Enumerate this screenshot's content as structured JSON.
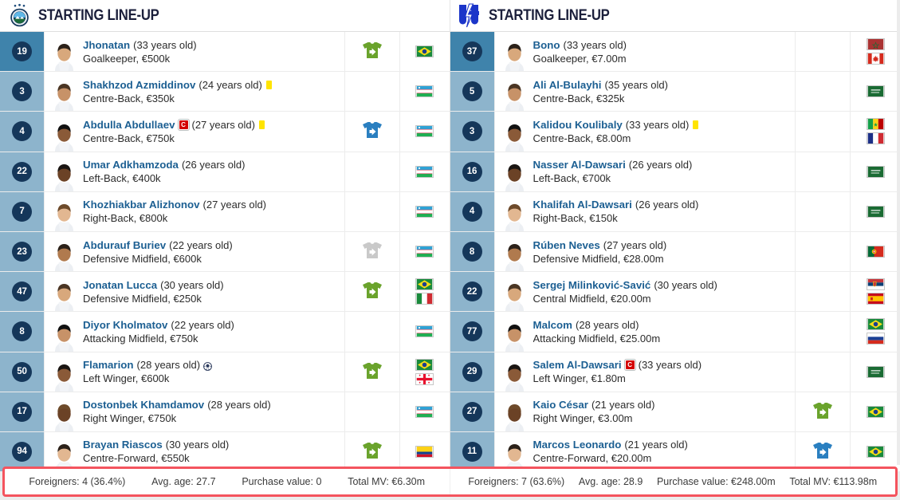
{
  "left": {
    "header": {
      "title": "STARTING LINE-UP",
      "crest_name": "pakhtakor-crest"
    },
    "players": [
      {
        "number": "19",
        "name": "Jhonatan",
        "age": "(33 years old)",
        "position": "Goalkeeper, €500k",
        "captain": false,
        "yellow_card": false,
        "goal": false,
        "sub_off": false,
        "sub_icon": "sub-on-green",
        "flags": [
          "Brazil"
        ],
        "active": true
      },
      {
        "number": "3",
        "name": "Shakhzod Azmiddinov",
        "age": "(24 years old)",
        "position": "Centre-Back, €350k",
        "captain": false,
        "yellow_card": true,
        "goal": false,
        "sub_off": false,
        "sub_icon": "none",
        "flags": [
          "Uzbekistan"
        ],
        "active": false
      },
      {
        "number": "4",
        "name": "Abdulla Abdullaev",
        "age": "(27 years old)",
        "position": "Centre-Back, €750k",
        "captain": true,
        "yellow_card": true,
        "goal": false,
        "sub_off": false,
        "sub_icon": "sub-off-blue",
        "flags": [
          "Uzbekistan"
        ],
        "active": false
      },
      {
        "number": "22",
        "name": "Umar Adkhamzoda",
        "age": "(26 years old)",
        "position": "Left-Back, €400k",
        "captain": false,
        "yellow_card": false,
        "goal": false,
        "sub_off": true,
        "sub_icon": "none",
        "flags": [
          "Uzbekistan"
        ],
        "active": false
      },
      {
        "number": "7",
        "name": "Khozhiakbar Alizhonov",
        "age": "(27 years old)",
        "position": "Right-Back, €800k",
        "captain": false,
        "yellow_card": false,
        "goal": false,
        "sub_off": false,
        "sub_icon": "none",
        "flags": [
          "Uzbekistan"
        ],
        "active": false
      },
      {
        "number": "23",
        "name": "Abdurauf Buriev",
        "age": "(22 years old)",
        "position": "Defensive Midfield, €600k",
        "captain": false,
        "yellow_card": false,
        "goal": false,
        "sub_off": false,
        "sub_icon": "sub-grey",
        "flags": [
          "Uzbekistan"
        ],
        "active": false
      },
      {
        "number": "47",
        "name": "Jonatan Lucca",
        "age": "(30 years old)",
        "position": "Defensive Midfield, €250k",
        "captain": false,
        "yellow_card": false,
        "goal": false,
        "sub_off": false,
        "sub_icon": "sub-on-green",
        "flags": [
          "Brazil",
          "Italy"
        ],
        "active": false
      },
      {
        "number": "8",
        "name": "Diyor Kholmatov",
        "age": "(22 years old)",
        "position": "Attacking Midfield, €750k",
        "captain": false,
        "yellow_card": false,
        "goal": false,
        "sub_off": true,
        "sub_icon": "none",
        "flags": [
          "Uzbekistan"
        ],
        "active": false
      },
      {
        "number": "50",
        "name": "Flamarion",
        "age": "(28 years old)",
        "position": "Left Winger, €600k",
        "captain": false,
        "yellow_card": false,
        "goal": true,
        "sub_off": true,
        "sub_icon": "sub-on-green",
        "flags": [
          "Brazil",
          "Georgia"
        ],
        "active": false
      },
      {
        "number": "17",
        "name": "Dostonbek Khamdamov",
        "age": "(28 years old)",
        "position": "Right Winger, €750k",
        "captain": false,
        "yellow_card": false,
        "goal": false,
        "sub_off": true,
        "sub_icon": "none",
        "flags": [
          "Uzbekistan"
        ],
        "active": false
      },
      {
        "number": "94",
        "name": "Brayan Riascos",
        "age": "(30 years old)",
        "position": "Centre-Forward, €550k",
        "captain": false,
        "yellow_card": false,
        "goal": false,
        "sub_off": true,
        "sub_icon": "sub-on-green",
        "flags": [
          "Colombia"
        ],
        "active": false
      }
    ],
    "summary": {
      "foreigners": "Foreigners: 4 (36.4%)",
      "avg_age": "Avg. age: 27.7",
      "purchase_value": "Purchase value: 0",
      "total_mv": "Total MV: €6.30m"
    }
  },
  "right": {
    "header": {
      "title": "STARTING LINE-UP",
      "crest_name": "al-hilal-crest"
    },
    "players": [
      {
        "number": "37",
        "name": "Bono",
        "age": "(33 years old)",
        "position": "Goalkeeper, €7.00m",
        "captain": false,
        "yellow_card": false,
        "goal": false,
        "sub_off": false,
        "sub_icon": "none",
        "flags": [
          "Morocco",
          "Canada"
        ],
        "active": true
      },
      {
        "number": "5",
        "name": "Ali Al-Bulayhi",
        "age": "(35 years old)",
        "position": "Centre-Back, €325k",
        "captain": false,
        "yellow_card": false,
        "goal": false,
        "sub_off": true,
        "sub_icon": "none",
        "flags": [
          "Saudi Arabia"
        ],
        "active": false
      },
      {
        "number": "3",
        "name": "Kalidou Koulibaly",
        "age": "(33 years old)",
        "position": "Centre-Back, €8.00m",
        "captain": false,
        "yellow_card": true,
        "goal": false,
        "sub_off": false,
        "sub_icon": "none",
        "flags": [
          "Senegal",
          "France"
        ],
        "active": false
      },
      {
        "number": "16",
        "name": "Nasser Al-Dawsari",
        "age": "(26 years old)",
        "position": "Left-Back, €700k",
        "captain": false,
        "yellow_card": false,
        "goal": false,
        "sub_off": false,
        "sub_icon": "none",
        "flags": [
          "Saudi Arabia"
        ],
        "active": false
      },
      {
        "number": "4",
        "name": "Khalifah Al-Dawsari",
        "age": "(26 years old)",
        "position": "Right-Back, €150k",
        "captain": false,
        "yellow_card": false,
        "goal": false,
        "sub_off": false,
        "sub_icon": "none",
        "flags": [
          "Saudi Arabia"
        ],
        "active": false
      },
      {
        "number": "8",
        "name": "Rúben Neves",
        "age": "(27 years old)",
        "position": "Defensive Midfield, €28.00m",
        "captain": false,
        "yellow_card": false,
        "goal": false,
        "sub_off": false,
        "sub_icon": "none",
        "flags": [
          "Portugal"
        ],
        "active": false
      },
      {
        "number": "22",
        "name": "Sergej Milinković-Savić",
        "age": "(30 years old)",
        "position": "Central Midfield, €20.00m",
        "captain": false,
        "yellow_card": false,
        "goal": false,
        "sub_off": true,
        "sub_icon": "none",
        "flags": [
          "Serbia",
          "Spain"
        ],
        "active": false
      },
      {
        "number": "77",
        "name": "Malcom",
        "age": "(28 years old)",
        "position": "Attacking Midfield, €25.00m",
        "captain": false,
        "yellow_card": false,
        "goal": false,
        "sub_off": false,
        "sub_icon": "none",
        "flags": [
          "Brazil",
          "Russia"
        ],
        "active": false
      },
      {
        "number": "29",
        "name": "Salem Al-Dawsari",
        "age": "(33 years old)",
        "position": "Left Winger, €1.80m",
        "captain": true,
        "yellow_card": false,
        "goal": false,
        "sub_off": false,
        "sub_icon": "none",
        "flags": [
          "Saudi Arabia"
        ],
        "active": false
      },
      {
        "number": "27",
        "name": "Kaio César",
        "age": "(21 years old)",
        "position": "Right Winger, €3.00m",
        "captain": false,
        "yellow_card": false,
        "goal": false,
        "sub_off": true,
        "sub_icon": "sub-on-green",
        "flags": [
          "Brazil"
        ],
        "active": false
      },
      {
        "number": "11",
        "name": "Marcos Leonardo",
        "age": "(21 years old)",
        "position": "Centre-Forward, €20.00m",
        "captain": false,
        "yellow_card": false,
        "goal": false,
        "sub_off": false,
        "sub_icon": "sub-off-blue",
        "flags": [
          "Brazil"
        ],
        "active": false
      }
    ],
    "summary": {
      "foreigners": "Foreigners: 7 (63.6%)",
      "avg_age": "Avg. age: 28.9",
      "purchase_value": "Purchase value: €248.00m",
      "total_mv": "Total MV: €113.98m"
    }
  },
  "colors": {
    "name_link": "#1c5f92",
    "num_badge": "#15375a",
    "num_cell": "#8db4cc",
    "num_cell_active": "#3f83ab",
    "sub_on": "#6aa32c",
    "sub_off": "#2a7fc0",
    "sub_disabled": "#c9c9c9",
    "yellow_card": "#ffe400",
    "summary_border": "#f4545e"
  }
}
